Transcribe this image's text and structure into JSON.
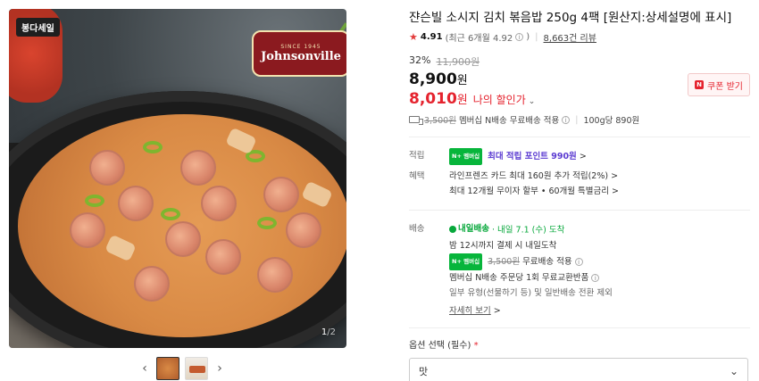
{
  "gallery": {
    "badge": "봉다세일",
    "brand": {
      "crest": "SINCE 1945",
      "wordmark": "Johnsonville"
    },
    "counter": {
      "current": "1",
      "total": "/2"
    },
    "prev_label": "‹",
    "next_label": "›",
    "thumbnails": [
      "thumb-1",
      "thumb-2"
    ]
  },
  "product": {
    "title": "쟌슨빌 소시지 김치 볶음밥 250g 4팩 [원산지:상세설명에 표시]",
    "rating": {
      "score": "4.91",
      "recent": "(최근 6개월 4.92",
      "recent_end": ")",
      "reviews": "8,663건 리뷰"
    },
    "discount_rate": "32%",
    "original_price": "11,900원",
    "price": "8,900",
    "price_unit": "원",
    "my_price": "8,010",
    "my_price_unit": "원",
    "my_price_label": "나의 할인가",
    "coupon_label": "쿠폰 받기",
    "coupon_n": "N",
    "shipping": {
      "old_fee": "3,500원",
      "text": "멤버십 N배송 무료배송 적용",
      "unit_price": "100g당 890원"
    }
  },
  "benefits": {
    "points_key": "적립",
    "points_badge": "N+ 멤버십",
    "points_text": "최대 적립 포인트 990원",
    "points_arrow": ">",
    "perks_key": "혜택",
    "perk1": "라인프렌즈 카드 최대 160원 추가 적립(2%) >",
    "perk2": "최대 12개월 무이자 할부 • 60개월 특별금리 >"
  },
  "delivery": {
    "key": "배송",
    "badge": "내일배송",
    "eta": "· 내일 7.1 (수) 도착",
    "line1": "밤 12시까지 결제 시 내일도착",
    "npay_badge": "N+ 멤버십",
    "old_fee": "3,500원",
    "line2_rest": "무료배송 적용",
    "line3": "멤버십 N배송 주문당 1회 무료교환반품",
    "line4": "일부 유형(선물하기 등) 및 일반배송 전환 제외",
    "detail": "자세히 보기",
    "detail_arrow": ">"
  },
  "options": {
    "label": "옵션 선택 (필수)",
    "required_mark": "*",
    "select_value": "맛",
    "chevron": "⌄"
  },
  "colors": {
    "accent_red": "#e5232e",
    "npay_green": "#07b53b",
    "points_purple": "#5b3bd1"
  }
}
